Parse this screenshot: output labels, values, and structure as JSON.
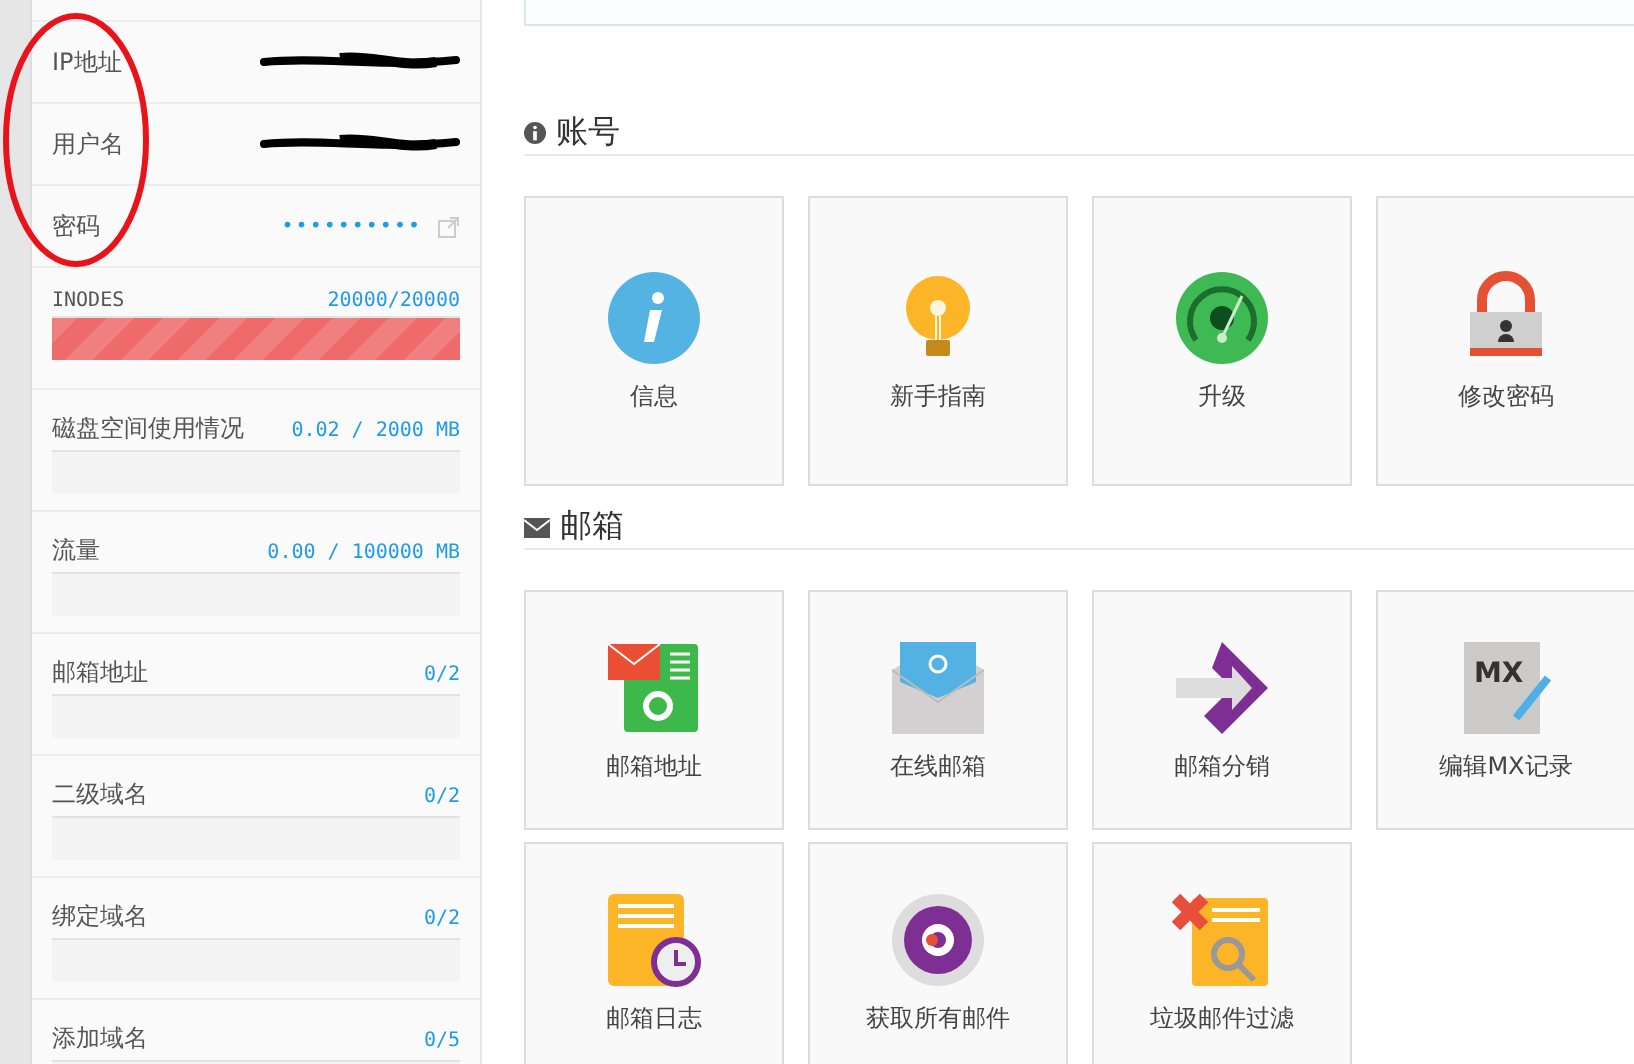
{
  "sidebar": {
    "fields": [
      {
        "label": "IP地址",
        "redacted": true
      },
      {
        "label": "用户名",
        "redacted": true
      },
      {
        "label": "密码",
        "value": "••••••••••"
      }
    ],
    "meters": [
      {
        "label": "INODES",
        "reading": "20000/20000",
        "level": 1
      },
      {
        "label": "磁盘空间使用情况",
        "reading": "0.02 / 2000 MB",
        "level": 0
      },
      {
        "label": "流量",
        "reading": "0.00 / 100000 MB",
        "level": 0
      },
      {
        "label": "邮箱地址",
        "reading": "0/2",
        "level": 0
      },
      {
        "label": "二级域名",
        "reading": "0/2",
        "level": 0
      },
      {
        "label": "绑定域名",
        "reading": "0/2",
        "level": 0
      },
      {
        "label": "添加域名",
        "reading": "0/5",
        "level": 0
      }
    ]
  },
  "sections": [
    {
      "kind": "info",
      "title": "账号",
      "tiles": [
        {
          "kind": "info",
          "label": "信息"
        },
        {
          "kind": "bulb",
          "label": "新手指南"
        },
        {
          "kind": "gauge",
          "label": "升级"
        },
        {
          "kind": "lock",
          "label": "修改密码"
        }
      ]
    },
    {
      "kind": "mail",
      "title": "邮箱",
      "tiles": [
        {
          "kind": "mail-list",
          "label": "邮箱地址"
        },
        {
          "kind": "envelope",
          "label": "在线邮箱"
        },
        {
          "kind": "arrow",
          "label": "邮箱分销"
        },
        {
          "kind": "mx",
          "label": "编辑MX记录",
          "badge": "MX"
        },
        {
          "kind": "log",
          "label": "邮箱日志"
        },
        {
          "kind": "target",
          "label": "获取所有邮件"
        },
        {
          "kind": "spam",
          "label": "垃圾邮件过滤"
        }
      ]
    }
  ],
  "annotation": {
    "kind": "ellipse"
  }
}
